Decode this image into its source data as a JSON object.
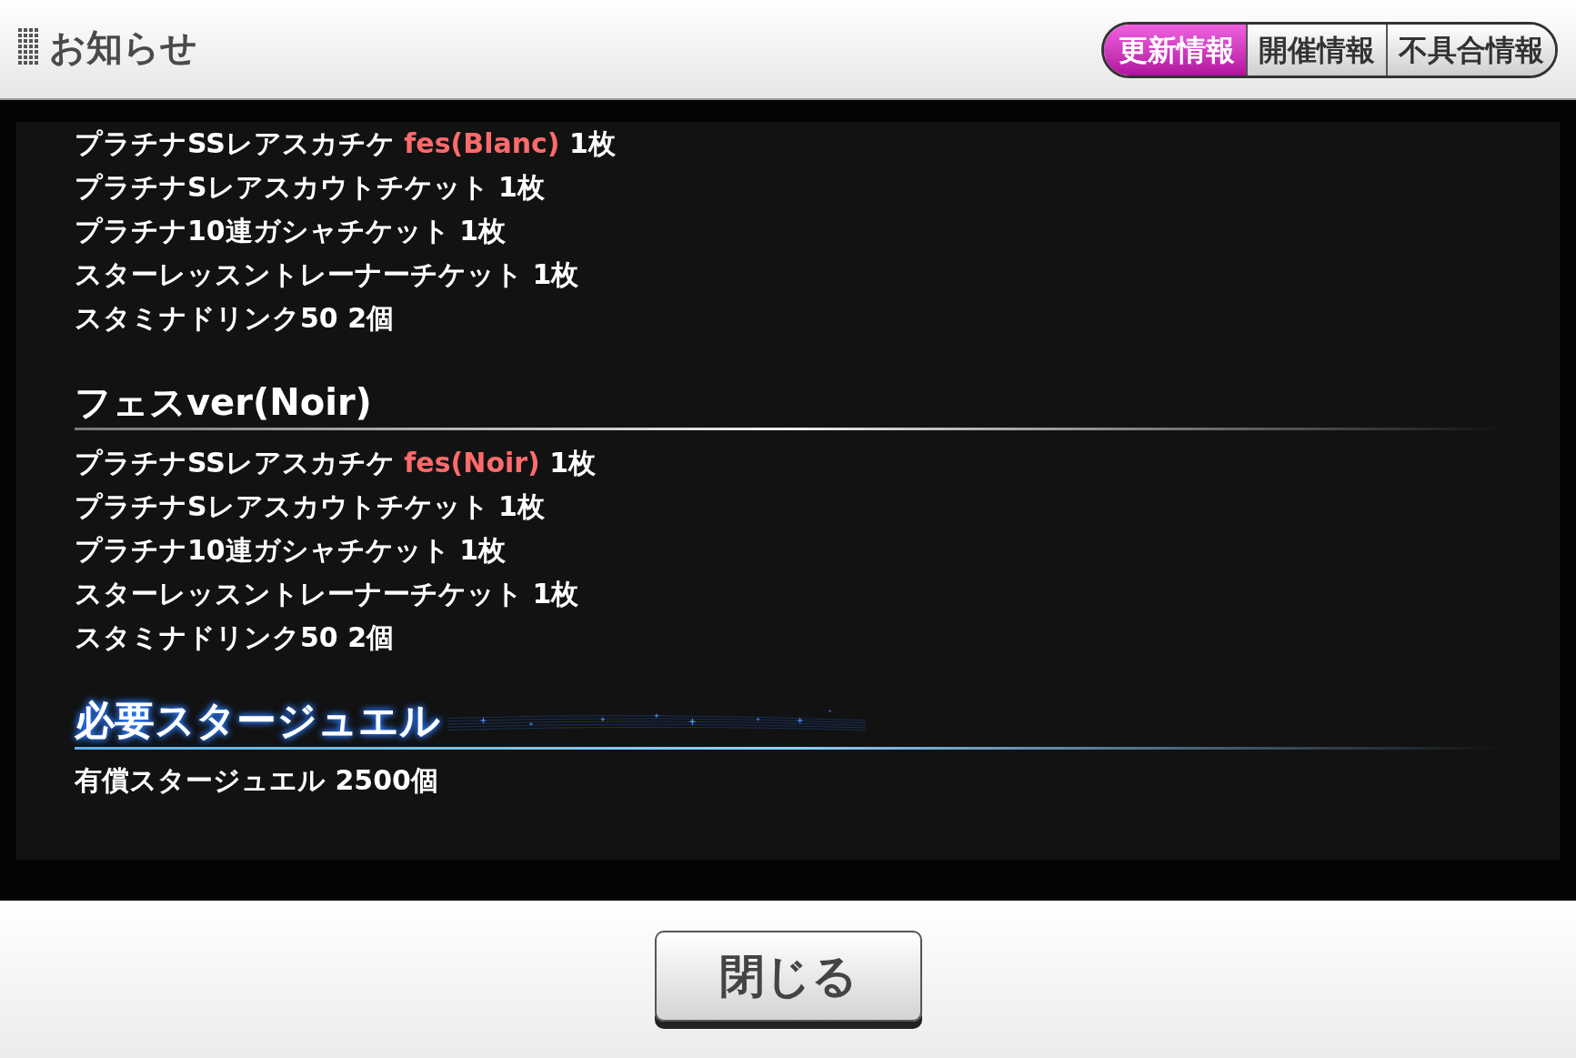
{
  "header": {
    "title": "お知らせ"
  },
  "tabs": [
    {
      "label": "更新情報",
      "selected": true
    },
    {
      "label": "開催情報",
      "selected": false
    },
    {
      "label": "不具合情報",
      "selected": false
    }
  ],
  "sections": [
    {
      "items": [
        {
          "parts": [
            {
              "text": "プラチナSSレアスカチケ ",
              "highlighted": false
            },
            {
              "text": "fes(Blanc)",
              "highlighted": true
            },
            {
              "text": " 1枚",
              "highlighted": false
            }
          ]
        },
        {
          "parts": [
            {
              "text": "プラチナSレアスカウトチケット 1枚",
              "highlighted": false
            }
          ]
        },
        {
          "parts": [
            {
              "text": "プラチナ10連ガシャチケット 1枚",
              "highlighted": false
            }
          ]
        },
        {
          "parts": [
            {
              "text": "スターレッスントレーナーチケット 1枚",
              "highlighted": false
            }
          ]
        },
        {
          "parts": [
            {
              "text": "スタミナドリンク50 2個",
              "highlighted": false
            }
          ]
        }
      ]
    },
    {
      "heading": {
        "text": "フェスver(Noir)",
        "kind": "plain"
      },
      "items": [
        {
          "parts": [
            {
              "text": "プラチナSSレアスカチケ ",
              "highlighted": false
            },
            {
              "text": "fes(Noir)",
              "highlighted": true
            },
            {
              "text": " 1枚",
              "highlighted": false
            }
          ]
        },
        {
          "parts": [
            {
              "text": "プラチナSレアスカウトチケット 1枚",
              "highlighted": false
            }
          ]
        },
        {
          "parts": [
            {
              "text": "プラチナ10連ガシャチケット 1枚",
              "highlighted": false
            }
          ]
        },
        {
          "parts": [
            {
              "text": "スターレッスントレーナーチケット 1枚",
              "highlighted": false
            }
          ]
        },
        {
          "parts": [
            {
              "text": "スタミナドリンク50 2個",
              "highlighted": false
            }
          ]
        }
      ]
    },
    {
      "heading": {
        "text": "必要スタージュエル",
        "kind": "glow"
      },
      "items": [
        {
          "parts": [
            {
              "text": "有償スタージュエル 2500個",
              "highlighted": false
            }
          ]
        }
      ]
    }
  ],
  "footer": {
    "button": "閉じる"
  }
}
